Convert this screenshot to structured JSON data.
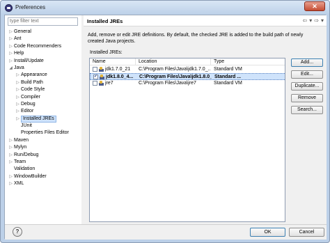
{
  "window": {
    "title": "Preferences",
    "close_label": "✕"
  },
  "sidebar": {
    "filter_placeholder": "type filter text",
    "items": [
      {
        "label": "General",
        "level": 0,
        "arrow": "▷"
      },
      {
        "label": "Ant",
        "level": 0,
        "arrow": "▷"
      },
      {
        "label": "Code Recommenders",
        "level": 0,
        "arrow": "▷"
      },
      {
        "label": "Help",
        "level": 0,
        "arrow": "▷"
      },
      {
        "label": "Install/Update",
        "level": 0,
        "arrow": "▷"
      },
      {
        "label": "Java",
        "level": 0,
        "arrow": "◢"
      },
      {
        "label": "Appearance",
        "level": 1,
        "arrow": "▷"
      },
      {
        "label": "Build Path",
        "level": 1,
        "arrow": "▷"
      },
      {
        "label": "Code Style",
        "level": 1,
        "arrow": "▷"
      },
      {
        "label": "Compiler",
        "level": 1,
        "arrow": "▷"
      },
      {
        "label": "Debug",
        "level": 1,
        "arrow": "▷"
      },
      {
        "label": "Editor",
        "level": 1,
        "arrow": "▷"
      },
      {
        "label": "Installed JREs",
        "level": 1,
        "arrow": "▷",
        "selected": true
      },
      {
        "label": "JUnit",
        "level": 1,
        "arrow": ""
      },
      {
        "label": "Properties Files Editor",
        "level": 1,
        "arrow": ""
      },
      {
        "label": "Maven",
        "level": 0,
        "arrow": "▷"
      },
      {
        "label": "Mylyn",
        "level": 0,
        "arrow": "▷"
      },
      {
        "label": "Run/Debug",
        "level": 0,
        "arrow": "▷"
      },
      {
        "label": "Team",
        "level": 0,
        "arrow": "▷"
      },
      {
        "label": "Validation",
        "level": 0,
        "arrow": ""
      },
      {
        "label": "WindowBuilder",
        "level": 0,
        "arrow": "▷"
      },
      {
        "label": "XML",
        "level": 0,
        "arrow": "▷"
      }
    ]
  },
  "page": {
    "title": "Installed JREs",
    "nav": {
      "back": "⇦",
      "back_menu": "▾",
      "forward": "⇨",
      "forward_menu": "▾"
    },
    "description": "Add, remove or edit JRE definitions. By default, the checked JRE is added to the build path of newly created Java projects.",
    "installed_label": "Installed JREs:",
    "table": {
      "columns": [
        "Name",
        "Location",
        "Type"
      ],
      "rows": [
        {
          "name": "jdk1.7.0_21",
          "location": "C:\\Program Files\\Java\\jdk1.7.0_...",
          "type": "Standard VM",
          "checked": false,
          "selected": false,
          "bold": false
        },
        {
          "name": "jdk1.8.0_4...",
          "location": "C:\\Program Files\\Java\\jdk1.8.0_...",
          "type": "Standard ...",
          "checked": true,
          "selected": true,
          "bold": true
        },
        {
          "name": "jre7",
          "location": "C:\\Program Files\\Java\\jre7",
          "type": "Standard VM",
          "checked": false,
          "selected": false,
          "bold": false
        }
      ]
    },
    "buttons": {
      "add": "Add...",
      "edit": "Edit...",
      "duplicate": "Duplicate...",
      "remove": "Remove",
      "search": "Search..."
    }
  },
  "footer": {
    "help": "?",
    "ok": "OK",
    "cancel": "Cancel"
  }
}
